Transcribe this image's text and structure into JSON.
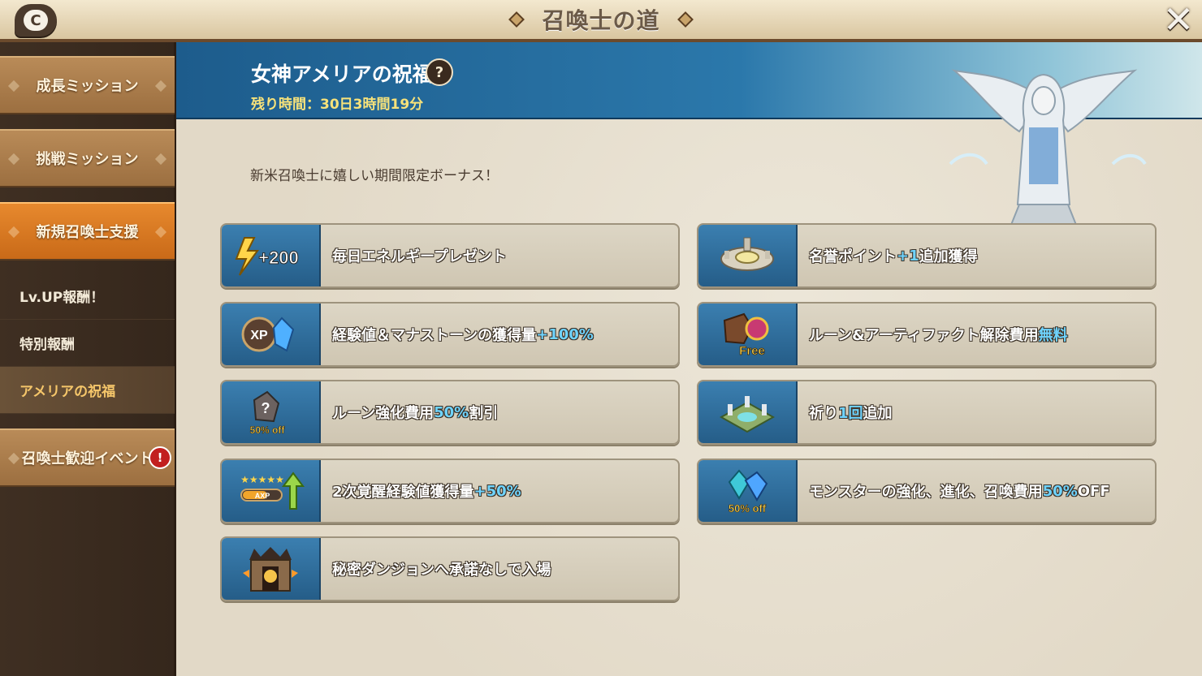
{
  "header": {
    "title": "召喚士の道",
    "chat_label": "C",
    "close_label": "✕"
  },
  "sidebar": {
    "tabs": [
      {
        "label": "成長ミッション"
      },
      {
        "label": "挑戦ミッション"
      },
      {
        "label": "新規召喚士支援"
      }
    ],
    "sub_items": [
      {
        "label": "Lv.UP報酬！"
      },
      {
        "label": "特別報酬"
      },
      {
        "label": "アメリアの祝福"
      }
    ],
    "event_tab": {
      "label": "召喚士歓迎イベント",
      "badge": "!"
    },
    "active_tab": "新規召喚士支援",
    "active_sub_item": "アメリアの祝福"
  },
  "banner": {
    "title": "女神アメリアの祝福",
    "help": "?",
    "timer": "残り時間：30日3時間19分"
  },
  "main": {
    "subtitle": "新米召喚士に嬉しい期間限定ボーナス！"
  },
  "bonuses": [
    {
      "icon": "energy-icon",
      "icon_text": "+200",
      "text_a": "毎日エネルギープレゼント",
      "hl": "",
      "text_b": ""
    },
    {
      "icon": "honor-arena-icon",
      "icon_text": "",
      "text_a": "名誉ポイント",
      "hl": "+1",
      "text_b": "追加獲得"
    },
    {
      "icon": "xp-crystal-icon",
      "icon_text": "XP",
      "text_a": "経験値＆マナストーンの獲得量",
      "hl": "+100%",
      "text_b": ""
    },
    {
      "icon": "rune-free-icon",
      "icon_text": "Free",
      "text_a": "ルーン&アーティファクト解除費用",
      "hl": "無料",
      "text_b": ""
    },
    {
      "icon": "rune-discount-icon",
      "icon_text": "50% off",
      "text_a": "ルーン強化費用",
      "hl": "50%",
      "text_b": "割引"
    },
    {
      "icon": "altar-icon",
      "icon_text": "",
      "text_a": "祈り",
      "hl": "1回",
      "text_b": "追加"
    },
    {
      "icon": "awaken-xp-icon",
      "icon_text": "AXP",
      "text_a": "2次覚醒経験値獲得量",
      "hl": "+50%",
      "text_b": ""
    },
    {
      "icon": "crystal-discount-icon",
      "icon_text": "50% off",
      "text_a": "モンスターの強化、進化、召喚費用",
      "hl": "50%",
      "text_b": "OFF"
    },
    {
      "icon": "secret-dungeon-icon",
      "icon_text": "",
      "text_a": "秘密ダンジョンへ承諾なしで入場",
      "hl": "",
      "text_b": ""
    }
  ],
  "colors": {
    "banner_blue": "#1d5c8c",
    "active_tab_orange": "#e7892e",
    "highlight_cyan": "#6fd4ff",
    "timer_yellow": "#f7e27a"
  }
}
